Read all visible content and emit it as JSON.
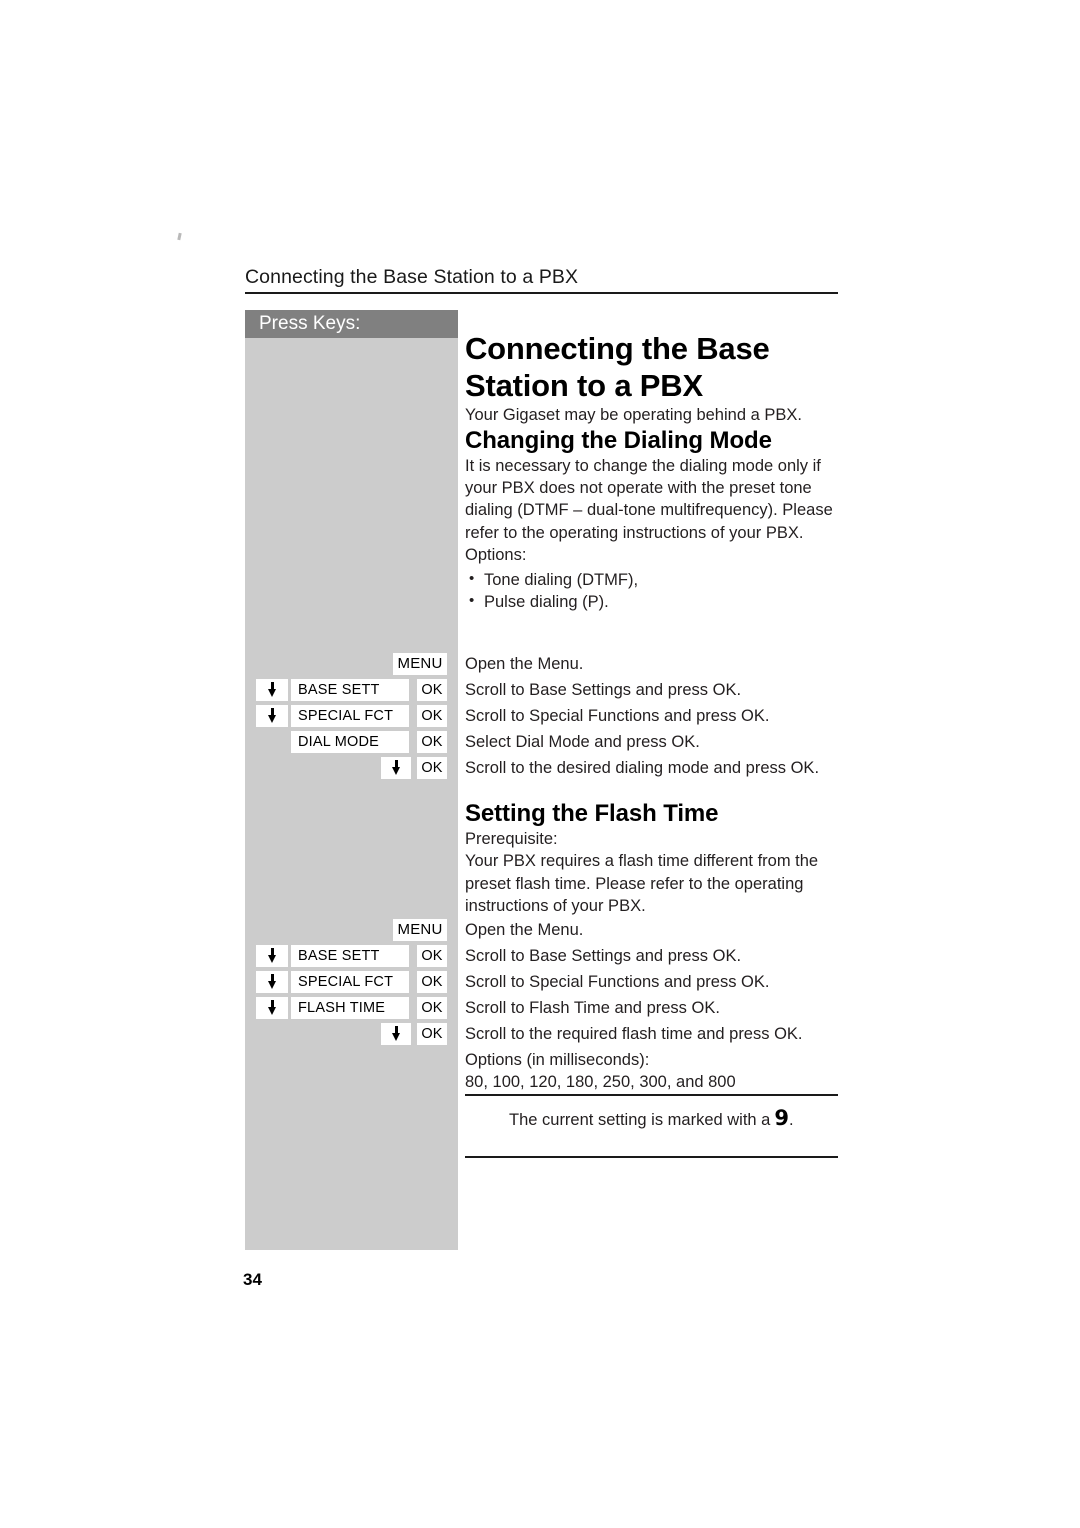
{
  "page": {
    "running_header": "Connecting the Base Station to a PBX",
    "number": "34"
  },
  "keys_panel": {
    "header_label": "Press Keys:",
    "background_color": "#cccccc",
    "header_color": "#808080"
  },
  "content": {
    "title": "Connecting the Base Station to a PBX",
    "intro": "Your Gigaset may be operating behind a PBX.",
    "section_1": {
      "heading": "Changing the Dialing Mode",
      "paragraph": "It is necessary to change the dialing mode only if your PBX does not operate with the preset tone dialing (DTMF – dual-tone multifrequency). Please refer to the operating instructions of your PBX.",
      "options_label": "Options:",
      "options": [
        "Tone dialing (DTMF),",
        "Pulse dialing (P)."
      ],
      "steps": [
        {
          "keys": {
            "type": "menu",
            "menu_label": "MENU"
          },
          "description": "Open the Menu."
        },
        {
          "keys": {
            "type": "arrow-label-ok",
            "arrow": "down-arrow-icon",
            "label": "BASE SETT",
            "ok_label": "OK"
          },
          "description": "Scroll to Base Settings and press OK."
        },
        {
          "keys": {
            "type": "arrow-label-ok",
            "arrow": "down-arrow-icon",
            "label": "SPECIAL FCT",
            "ok_label": "OK"
          },
          "description": "Scroll to Special Functions and press OK."
        },
        {
          "keys": {
            "type": "label-ok",
            "label": "DIAL MODE",
            "ok_label": "OK"
          },
          "description": "Select Dial Mode and press OK."
        },
        {
          "keys": {
            "type": "arrow-ok",
            "arrow": "down-arrow-icon",
            "ok_label": "OK"
          },
          "description": "Scroll to the desired dialing mode and press OK."
        }
      ]
    },
    "section_2": {
      "heading": "Setting the Flash Time",
      "prerequisite_label": "Prerequisite:",
      "paragraph": "Your PBX requires a flash time different from the preset flash time. Please refer to the operating instructions of your PBX.",
      "steps": [
        {
          "keys": {
            "type": "menu",
            "menu_label": "MENU"
          },
          "description": "Open the Menu."
        },
        {
          "keys": {
            "type": "arrow-label-ok",
            "arrow": "down-arrow-icon",
            "label": "BASE SETT",
            "ok_label": "OK"
          },
          "description": "Scroll to Base Settings and press OK."
        },
        {
          "keys": {
            "type": "arrow-label-ok",
            "arrow": "down-arrow-icon",
            "label": "SPECIAL FCT",
            "ok_label": "OK"
          },
          "description": "Scroll to Special Functions and press OK."
        },
        {
          "keys": {
            "type": "arrow-label-ok",
            "arrow": "down-arrow-icon",
            "label": "FLASH TIME",
            "ok_label": "OK"
          },
          "description": "Scroll to Flash Time and press OK."
        },
        {
          "keys": {
            "type": "arrow-ok",
            "arrow": "down-arrow-icon",
            "ok_label": "OK"
          },
          "description": "Scroll to the required flash time and press OK."
        }
      ],
      "options_label": "Options (in milliseconds):",
      "options_values": "80, 100, 120, 180, 250, 300, and 800"
    },
    "note": {
      "text": "The current setting is marked with a",
      "mark": "9",
      "trailing": "."
    }
  }
}
